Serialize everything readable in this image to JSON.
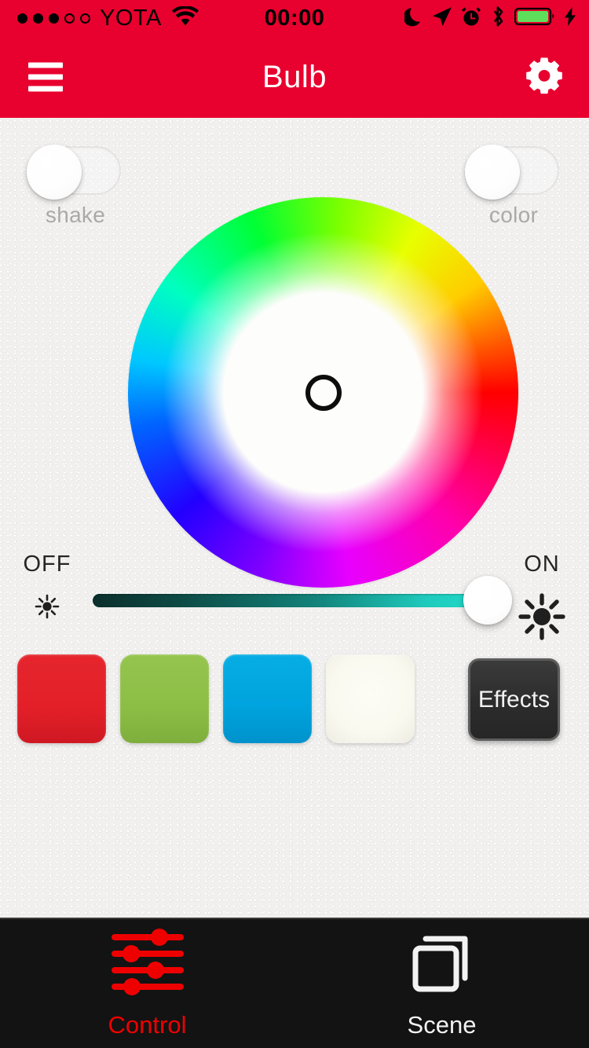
{
  "status_bar": {
    "carrier": "YOTA",
    "time": "00:00",
    "signal_dots_total": 5,
    "signal_dots_filled": 3,
    "icons": [
      "wifi-icon",
      "moon-icon",
      "location-arrow-icon",
      "alarm-clock-icon",
      "bluetooth-icon",
      "battery-icon",
      "charging-bolt-icon"
    ],
    "battery_color": "#5ede5a"
  },
  "navbar": {
    "title": "Bulb",
    "menu_icon": "hamburger-menu-icon",
    "settings_icon": "gear-icon",
    "background_color": "#e8002e"
  },
  "toggles": [
    {
      "label": "shake",
      "state": "off",
      "name": "shake-toggle"
    },
    {
      "label": "color",
      "state": "off",
      "name": "color-toggle"
    }
  ],
  "color_wheel": {
    "name": "color-wheel",
    "selected_position": "center",
    "selector_icon": "wheel-cursor-ring"
  },
  "brightness": {
    "off_label": "OFF",
    "on_label": "ON",
    "off_icon": "small-sun-icon",
    "on_icon": "large-sun-icon",
    "value_percent": 92,
    "track_start_color": "#0b2f2c",
    "track_end_color": "#22e0cf"
  },
  "presets": [
    {
      "name": "preset-red",
      "color": "#e32028"
    },
    {
      "name": "preset-green",
      "color": "#8cbe45"
    },
    {
      "name": "preset-blue",
      "color": "#00a3dd"
    },
    {
      "name": "preset-white",
      "color": "#faf9f0"
    }
  ],
  "effects": {
    "label": "Effects"
  },
  "tabs": [
    {
      "label": "Control",
      "icon": "sliders-icon",
      "active": true,
      "color": "#ef0000"
    },
    {
      "label": "Scene",
      "icon": "layers-squares-icon",
      "active": false,
      "color": "#f2f2f2"
    }
  ]
}
